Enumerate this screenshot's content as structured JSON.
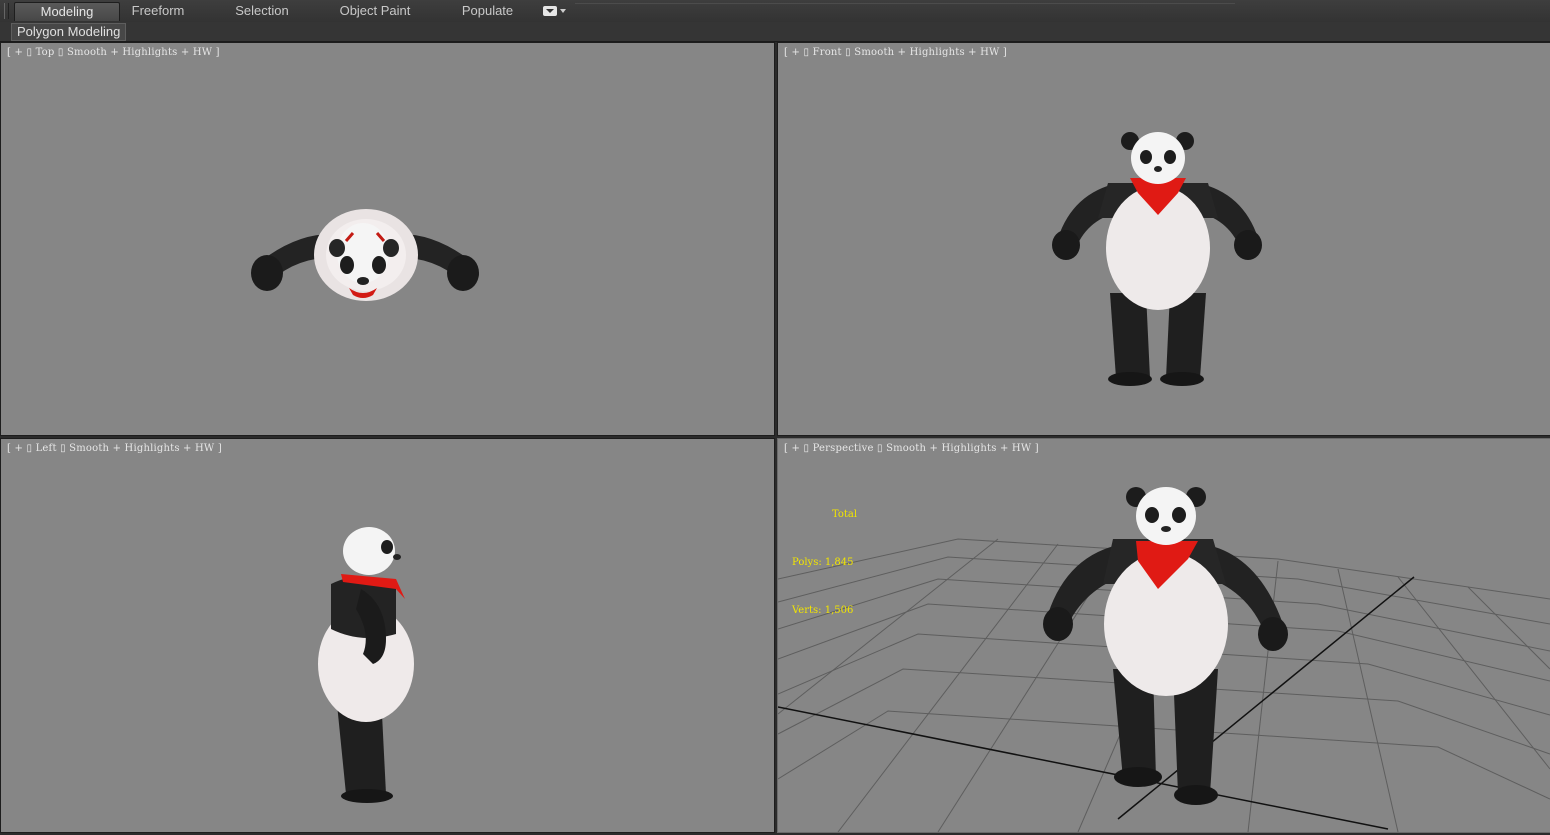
{
  "ribbon": {
    "tabs": [
      {
        "label": "Modeling",
        "active": true
      },
      {
        "label": "Freeform",
        "active": false
      },
      {
        "label": "Selection",
        "active": false
      },
      {
        "label": "Object Paint",
        "active": false
      },
      {
        "label": "Populate",
        "active": false
      }
    ],
    "menu_icon": "customize-ribbon-icon"
  },
  "panel": {
    "label": "Polygon Modeling"
  },
  "viewports": {
    "top": {
      "open_bracket": "[",
      "plus": "+",
      "name": "Top",
      "mode": "Smooth + Highlights + HW",
      "close_bracket": "]"
    },
    "front": {
      "open_bracket": "[",
      "plus": "+",
      "name": "Front",
      "mode": "Smooth + Highlights + HW",
      "close_bracket": "]"
    },
    "left": {
      "open_bracket": "[",
      "plus": "+",
      "name": "Left",
      "mode": "Smooth + Highlights + HW",
      "close_bracket": "]"
    },
    "perspective": {
      "open_bracket": "[",
      "plus": "+",
      "name": "Perspective",
      "mode": "Smooth + Highlights + HW",
      "close_bracket": "]",
      "stats": {
        "title": "Total",
        "polys_label": "Polys:",
        "polys_value": "1,845",
        "verts_label": "Verts:",
        "verts_value": "1,506"
      }
    }
  },
  "colors": {
    "viewport_bg": "#868686",
    "stats_text": "#f2e500",
    "scarf": "#e01a14",
    "fur_black": "#1e1e1e",
    "fur_white": "#efefef"
  }
}
